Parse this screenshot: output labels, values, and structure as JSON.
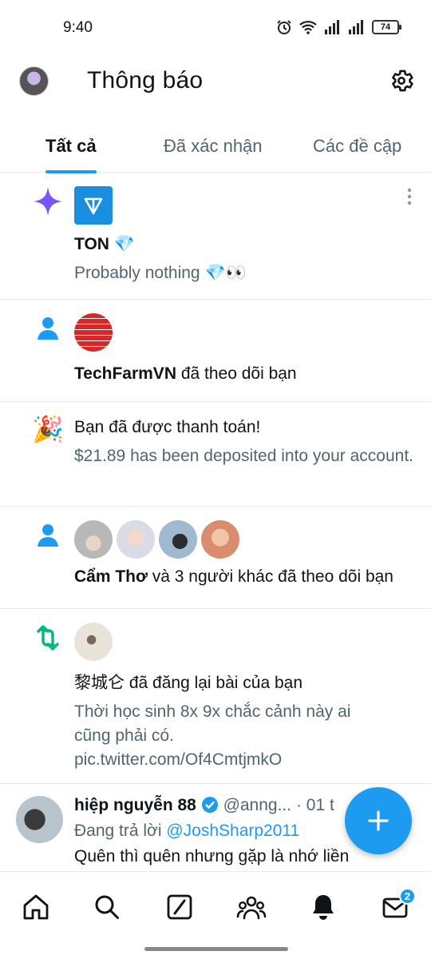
{
  "status_bar": {
    "time": "9:40",
    "battery": "74"
  },
  "header": {
    "title": "Thông báo"
  },
  "tabs": [
    {
      "label": "Tất cả",
      "active": true
    },
    {
      "label": "Đã xác nhận",
      "active": false
    },
    {
      "label": "Các đề cập",
      "active": false
    }
  ],
  "notifications": [
    {
      "type": "ton",
      "name": "TON 💎",
      "text": "Probably nothing 💎👀"
    },
    {
      "type": "follow",
      "name": "TechFarmVN",
      "action": " đã theo dõi bạn"
    },
    {
      "type": "payment",
      "title": "Bạn đã được thanh toán!",
      "text": "$21.89 has been deposited into your account."
    },
    {
      "type": "follow-multi",
      "name": "Cẩm Thơ",
      "action": " và 3 người khác đã theo dõi bạn"
    },
    {
      "type": "repost",
      "name": "黎城仑",
      "action": " đã đăng lại bài của bạn",
      "text": "Thời học sinh 8x 9x chắc cảnh này ai cũng phải có. pic.twitter.com/Of4CmtjmkO"
    },
    {
      "type": "reply",
      "name": "hiệp nguyễn 88",
      "handle": "@anng...",
      "time": "· 01 t",
      "reply_prefix": "Đang trả lời ",
      "reply_to": "@JoshSharp2011",
      "text": "Quên thì quên nhưng gặp là nhớ liền"
    }
  ],
  "bottom_nav": {
    "messages_badge": "2"
  },
  "colors": {
    "accent": "#1d9bf0",
    "repost": "#00ba7c",
    "sparkle": "#7856ff"
  }
}
